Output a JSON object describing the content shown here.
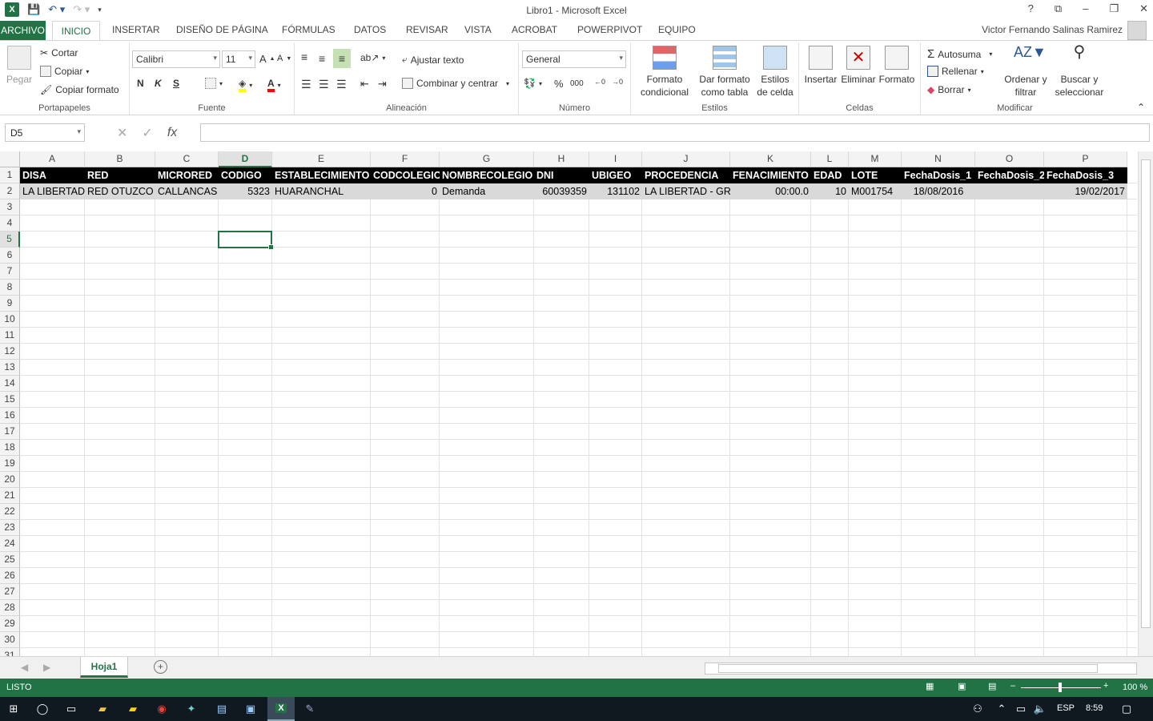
{
  "window": {
    "title": "Libro1 - Microsoft Excel",
    "user": "Victor Fernando Salinas Ramirez",
    "help": "?"
  },
  "tabs": {
    "file": "ARCHIVO",
    "home": "INICIO",
    "insert": "INSERTAR",
    "page_layout": "DISEÑO DE PÁGINA",
    "formulas": "FÓRMULAS",
    "data": "DATOS",
    "review": "REVISAR",
    "view": "VISTA",
    "acrobat": "ACROBAT",
    "powerpivot": "POWERPIVOT",
    "team": "EQUIPO"
  },
  "ribbon": {
    "clipboard": {
      "paste": "Pegar",
      "cut": "Cortar",
      "copy": "Copiar",
      "format_painter": "Copiar formato",
      "label": "Portapapeles"
    },
    "font": {
      "name": "Calibri",
      "size": "11",
      "bold": "N",
      "italic": "K",
      "underline": "S",
      "label": "Fuente"
    },
    "alignment": {
      "wrap": "Ajustar texto",
      "merge": "Combinar y centrar",
      "label": "Alineación"
    },
    "number": {
      "format": "General",
      "percent": "%",
      "thousands": "000",
      "label": "Número"
    },
    "styles": {
      "conditional": "Formato condicional",
      "as_table": "Dar formato como tabla",
      "cell_styles": "Estilos de celda",
      "label": "Estilos"
    },
    "cells": {
      "insert": "Insertar",
      "delete": "Eliminar",
      "format": "Formato",
      "label": "Celdas"
    },
    "editing": {
      "autosum": "Autosuma",
      "fill": "Rellenar",
      "clear": "Borrar",
      "sort": "Ordenar y filtrar",
      "find": "Buscar y seleccionar",
      "label": "Modificar"
    }
  },
  "formula_bar": {
    "name_box": "D5",
    "fx": "fx",
    "value": ""
  },
  "columns": [
    "A",
    "B",
    "C",
    "D",
    "E",
    "F",
    "G",
    "H",
    "I",
    "J",
    "K",
    "L",
    "M",
    "N",
    "O",
    "P"
  ],
  "header_row": [
    "DISA",
    "RED",
    "MICRORED",
    "CODIGO",
    "ESTABLECIMIENTO",
    "CODCOLEGIO",
    "NOMBRECOLEGIO",
    "DNI",
    "UBIGEO",
    "PROCEDENCIA",
    "FENACIMIENTO",
    "EDAD",
    "LOTE",
    "FechaDosis_1",
    "FechaDosis_2",
    "FechaDosis_3"
  ],
  "data_row": [
    "LA LIBERTAD",
    "RED OTUZCO",
    "CALLANCAS",
    "5323",
    "HUARANCHAL",
    "0",
    "Demanda",
    "60039359",
    "131102",
    "LA LIBERTAD - GRA",
    "00:00.0",
    "10",
    "M001754",
    "18/08/2016",
    "",
    "19/02/2017"
  ],
  "row_numbers": [
    "1",
    "2",
    "3",
    "4",
    "5",
    "6",
    "7",
    "8",
    "9",
    "10",
    "11",
    "12",
    "13",
    "14",
    "15",
    "16",
    "17",
    "18",
    "19",
    "20",
    "21",
    "22",
    "23",
    "24",
    "25",
    "26",
    "27",
    "28",
    "29",
    "30",
    "31"
  ],
  "selected_column": "D",
  "selected_row": "5",
  "sheet": {
    "name": "Hoja1"
  },
  "status": {
    "mode": "LISTO",
    "zoom": "100 %"
  },
  "taskbar": {
    "lang": "ESP",
    "time": "8:59"
  },
  "colors": {
    "accent": "#217346",
    "header_fill": "#000000",
    "data_fill": "#d9d9d9"
  }
}
